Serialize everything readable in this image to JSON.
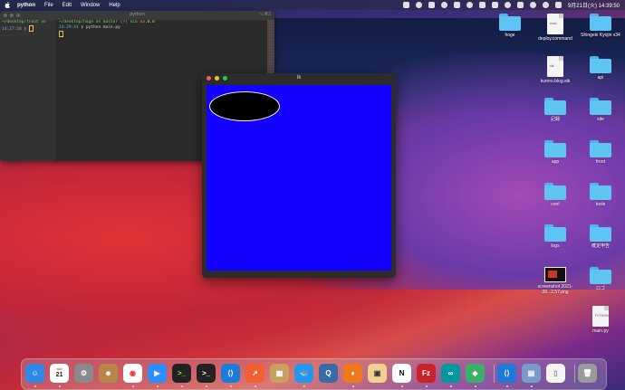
{
  "menubar": {
    "app_name": "python",
    "items": [
      "File",
      "Edit",
      "Window",
      "Help"
    ],
    "clock": "9月21日(火)  14:39:50"
  },
  "terminal": {
    "title": "python",
    "shortcut": "⌥⌘2",
    "left_pane": {
      "line1_path": "~/desktop/front on",
      "line2_time": "14:27:58",
      "line2_rest": "❯"
    },
    "right_pane": {
      "line1_path": "~/desktop/hoge on",
      "line1_branch": "master [?] via",
      "line1_version": "v3.8.8",
      "line2_time": "14:29:41",
      "line2_cmd": "❯ python main.py"
    }
  },
  "tk_window": {
    "title": "tk",
    "canvas_color": "#1400ff",
    "oval_fill": "#000000"
  },
  "desktop_icons": [
    {
      "label": "hoge",
      "type": "folder"
    },
    {
      "label": "deploy.command",
      "type": "doc",
      "tag": "exec"
    },
    {
      "label": "Shingeki Kyojin v34",
      "type": "folder"
    },
    {
      "label": "kuroro.blog.stk",
      "type": "doc",
      "tag": "stk"
    },
    {
      "label": "api",
      "type": "folder"
    },
    {
      "label": "記録",
      "type": "folder"
    },
    {
      "label": "site",
      "type": "folder"
    },
    {
      "label": "app",
      "type": "folder"
    },
    {
      "label": "front",
      "type": "folder"
    },
    {
      "label": "conf",
      "type": "folder"
    },
    {
      "label": "tools",
      "type": "folder"
    },
    {
      "label": "logs",
      "type": "folder"
    },
    {
      "label": "確定申告",
      "type": "folder"
    },
    {
      "label": "screenshot 2021-09...2.57.png",
      "type": "image"
    },
    {
      "label": "ロゴ",
      "type": "folder"
    },
    {
      "label": "main.py",
      "type": "doc",
      "tag": "PYTHON"
    }
  ],
  "dock": {
    "apps": [
      {
        "name": "finder",
        "glyph": "☺"
      },
      {
        "name": "calendar",
        "glyph": "21",
        "sub": "SEP"
      },
      {
        "name": "system-preferences",
        "glyph": "⚙"
      },
      {
        "name": "contacts",
        "glyph": "☻"
      },
      {
        "name": "chrome",
        "glyph": "◉"
      },
      {
        "name": "zoom",
        "glyph": "▶"
      },
      {
        "name": "terminal-1",
        "glyph": ">_"
      },
      {
        "name": "terminal-2",
        "glyph": ">_"
      },
      {
        "name": "vscode",
        "glyph": "⟨⟩"
      },
      {
        "name": "instruments",
        "glyph": "↗"
      },
      {
        "name": "archive",
        "glyph": "▦"
      },
      {
        "name": "docker",
        "glyph": "🐳"
      },
      {
        "name": "quicktime",
        "glyph": "Q"
      },
      {
        "name": "sourcetree",
        "glyph": "♦"
      },
      {
        "name": "preview",
        "glyph": "▣"
      },
      {
        "name": "notion",
        "glyph": "N"
      },
      {
        "name": "filezilla",
        "glyph": "Fz"
      },
      {
        "name": "arduino",
        "glyph": "∞"
      },
      {
        "name": "gitkraken",
        "glyph": "◈"
      },
      {
        "name": "vscode-2",
        "glyph": "⟨⟩"
      },
      {
        "name": "image-viewer",
        "glyph": "▤"
      },
      {
        "name": "document",
        "glyph": "▯"
      },
      {
        "name": "trash",
        "glyph": "🗑"
      }
    ]
  }
}
